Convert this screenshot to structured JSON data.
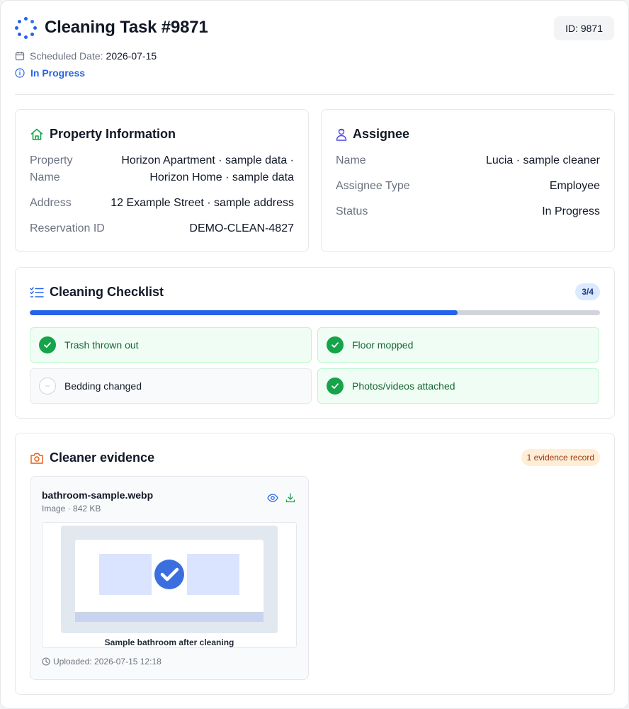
{
  "header": {
    "title": "Cleaning Task #9871",
    "id_chip": "ID: 9871",
    "scheduled_label": "Scheduled Date:",
    "scheduled_value": "2026-07-15",
    "status": "In Progress"
  },
  "property": {
    "title": "Property Information",
    "rows": [
      {
        "label": "Property Name",
        "value": "Horizon Apartment · sample data · Horizon Home · sample data"
      },
      {
        "label": "Address",
        "value": "12 Example Street · sample address"
      },
      {
        "label": "Reservation ID",
        "value": "DEMO-CLEAN-4827"
      }
    ]
  },
  "assignee": {
    "title": "Assignee",
    "rows": [
      {
        "label": "Name",
        "value": "Lucia · sample cleaner"
      },
      {
        "label": "Assignee Type",
        "value": "Employee"
      },
      {
        "label": "Status",
        "value": "In Progress"
      }
    ]
  },
  "checklist": {
    "title": "Cleaning Checklist",
    "count": "3/4",
    "progress": 0.75,
    "items": [
      {
        "label": "Trash thrown out",
        "done": true
      },
      {
        "label": "Floor mopped",
        "done": true
      },
      {
        "label": "Bedding changed",
        "done": false
      },
      {
        "label": "Photos/videos attached",
        "done": true
      }
    ]
  },
  "evidence": {
    "title": "Cleaner evidence",
    "badge": "1 evidence record",
    "file": {
      "name": "bathroom-sample.webp",
      "meta": "Image · 842 KB",
      "caption": "Sample bathroom after cleaning",
      "uploaded": "Uploaded: 2026-07-15 12:18"
    }
  },
  "colors": {
    "accent": "#2563eb",
    "success": "#16a34a",
    "warning_badge": "#ffedd5"
  }
}
